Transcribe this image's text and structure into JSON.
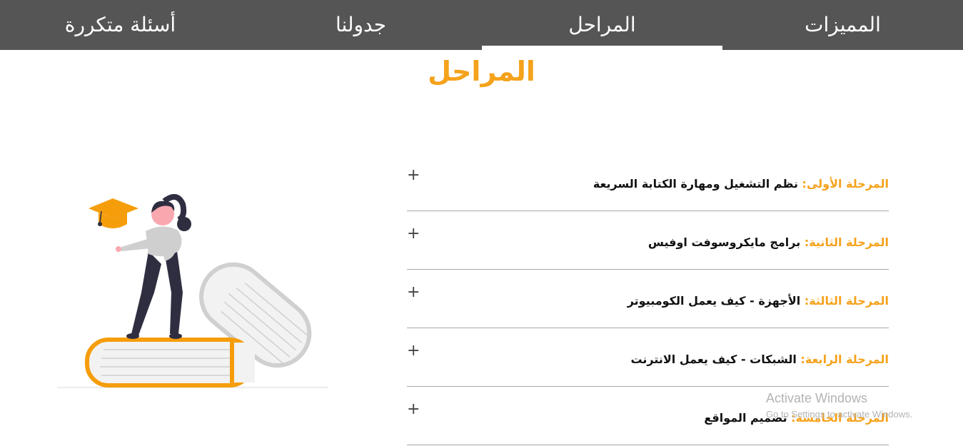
{
  "nav": {
    "faq": "أسئلة متكررة",
    "schedule": "جدولنا",
    "stages": "المراحل",
    "features": "المميزات"
  },
  "section": {
    "title": "المراحل"
  },
  "stages": [
    {
      "label": "المرحلة الأولى:",
      "text": " نظم التشغيل ومهارة الكتابة السريعة"
    },
    {
      "label": "المرحلة الثانية:",
      "text": " برامج مايكروسوفت اوفيس"
    },
    {
      "label": "المرحلة الثالثة:",
      "text": " الأجهزة - كيف يعمل الكومبيوتر"
    },
    {
      "label": "المرحلة الرابعة:",
      "text": " الشبكات - كيف يعمل الانترنت"
    },
    {
      "label": "المرحلة الخامسة:",
      "text": " تصميم المواقع"
    }
  ],
  "watermark": {
    "title": "Activate Windows",
    "subtitle": "Go to Settings to activate Windows."
  },
  "colors": {
    "accent": "#f5a21c",
    "nav_bg": "#555555"
  },
  "icons": {
    "expand": "plus-icon",
    "illustration": "student-on-books-illustration"
  }
}
